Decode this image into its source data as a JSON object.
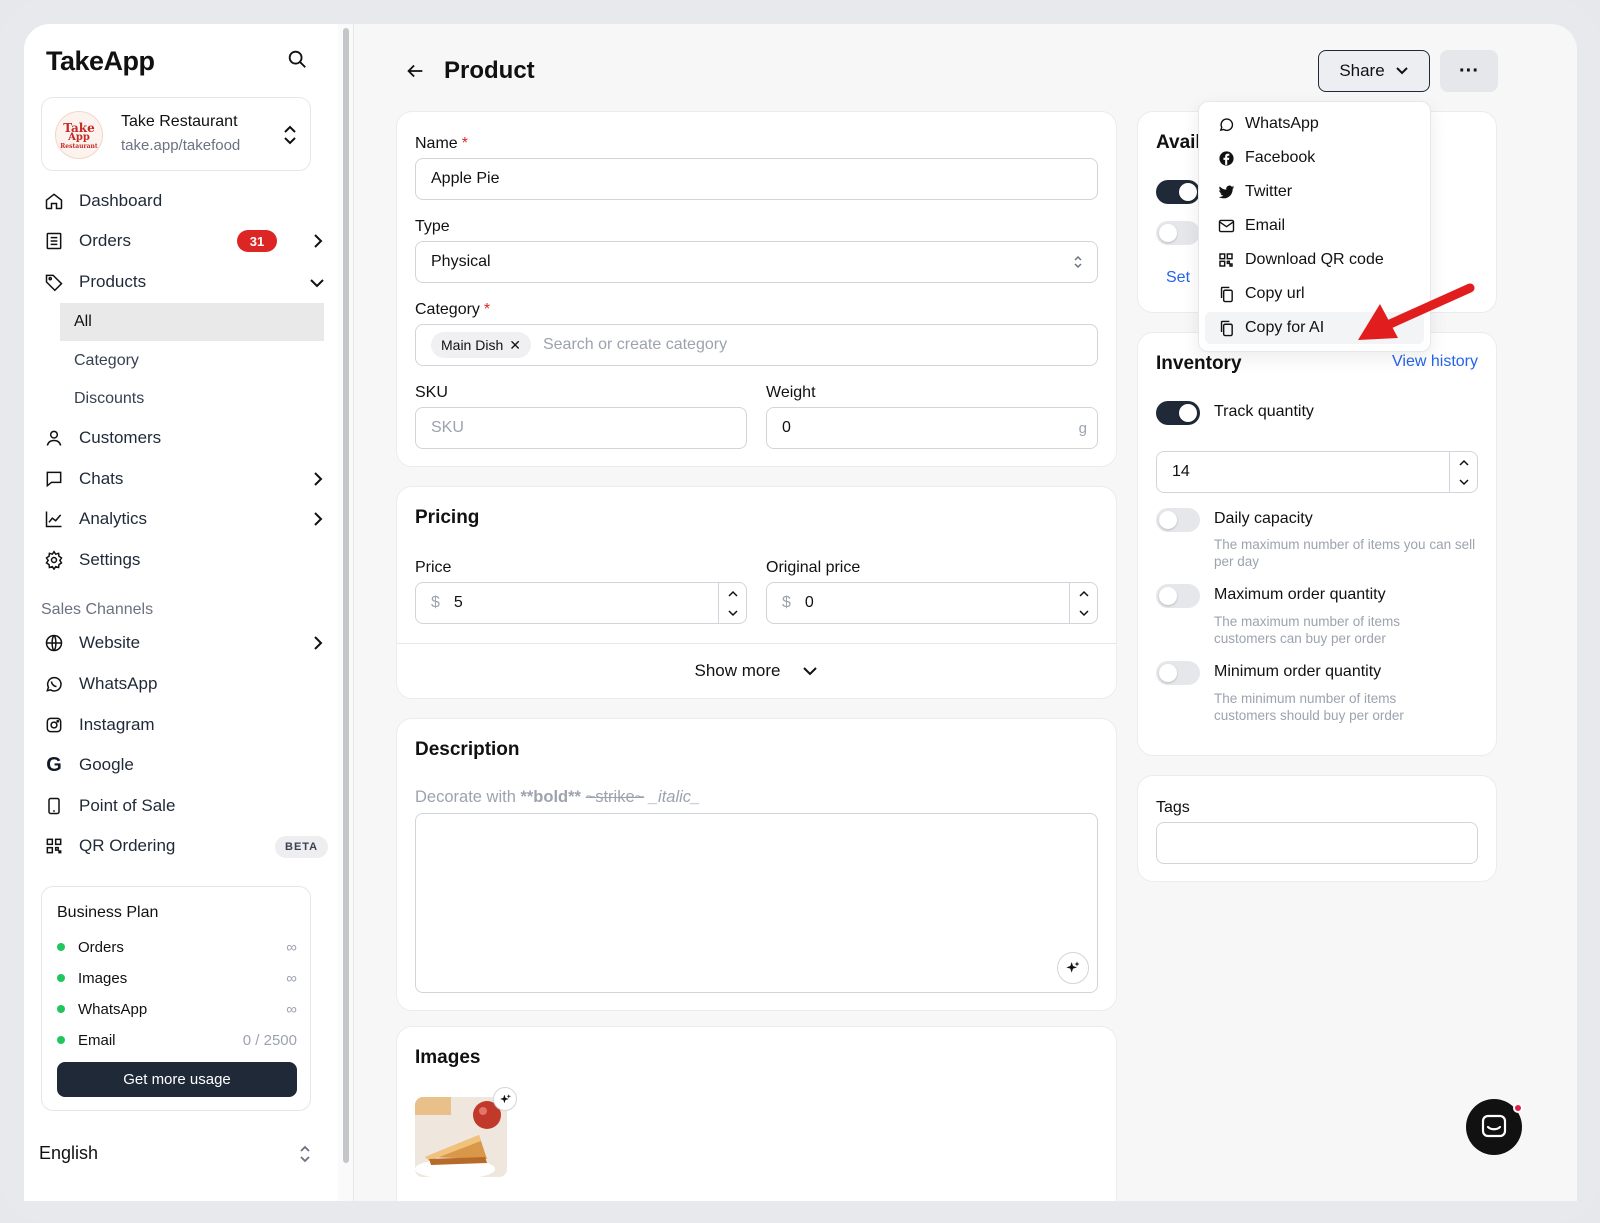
{
  "app": {
    "logo": "TakeApp"
  },
  "store": {
    "name": "Take Restaurant",
    "url": "take.app/takefood",
    "avatar_line1": "Take",
    "avatar_line2": "App",
    "avatar_line3": "Restaurant"
  },
  "nav": {
    "dashboard": "Dashboard",
    "orders": "Orders",
    "orders_badge": "31",
    "products": "Products",
    "products_sub": [
      "All",
      "Category",
      "Discounts"
    ],
    "customers": "Customers",
    "chats": "Chats",
    "analytics": "Analytics",
    "settings": "Settings"
  },
  "sales_channels": {
    "label": "Sales Channels",
    "website": "Website",
    "whatsapp": "WhatsApp",
    "instagram": "Instagram",
    "google": "Google",
    "pos": "Point of Sale",
    "qr": "QR Ordering",
    "qr_badge": "BETA"
  },
  "plan": {
    "title": "Business Plan",
    "rows": [
      {
        "label": "Orders",
        "value": "∞"
      },
      {
        "label": "Images",
        "value": "∞"
      },
      {
        "label": "WhatsApp",
        "value": "∞"
      },
      {
        "label": "Email",
        "value": "0 / 2500"
      }
    ],
    "button": "Get more usage"
  },
  "language": "English",
  "header": {
    "title": "Product",
    "share": "Share",
    "more": "···"
  },
  "details": {
    "name_label": "Name",
    "name_value": "Apple Pie",
    "type_label": "Type",
    "type_value": "Physical",
    "category_label": "Category",
    "category_chip": "Main Dish",
    "category_placeholder": "Search or create category",
    "sku_label": "SKU",
    "sku_placeholder": "SKU",
    "weight_label": "Weight",
    "weight_value": "0",
    "weight_unit": "g"
  },
  "pricing": {
    "title": "Pricing",
    "price_label": "Price",
    "price_currency": "$",
    "price_value": "5",
    "original_label": "Original price",
    "original_currency": "$",
    "original_value": "0",
    "show_more": "Show more"
  },
  "description": {
    "title": "Description",
    "hint_prefix": "Decorate with ",
    "hint_bold": "**bold**",
    "hint_strike": "~strike~",
    "hint_italic": "_italic_"
  },
  "images": {
    "title": "Images"
  },
  "availability": {
    "title_partial": "Avail",
    "set_partial": "Set"
  },
  "share_menu": {
    "items": [
      "WhatsApp",
      "Facebook",
      "Twitter",
      "Email",
      "Download QR code",
      "Copy url",
      "Copy for AI"
    ]
  },
  "inventory": {
    "title": "Inventory",
    "view_history": "View history",
    "track_label": "Track quantity",
    "quantity": "14",
    "daily_title": "Daily capacity",
    "daily_desc": "The maximum number of items you can sell per day",
    "max_title": "Maximum order quantity",
    "max_desc": "The maximum number of items customers can buy per order",
    "min_title": "Minimum order quantity",
    "min_desc": "The minimum number of items customers should buy per order"
  },
  "tags": {
    "title": "Tags"
  },
  "colors": {
    "accent": "#1f2937",
    "badge": "#dc2626",
    "link": "#2563eb",
    "status_dot": "#22c55e",
    "arrow": "#e11d1d"
  }
}
